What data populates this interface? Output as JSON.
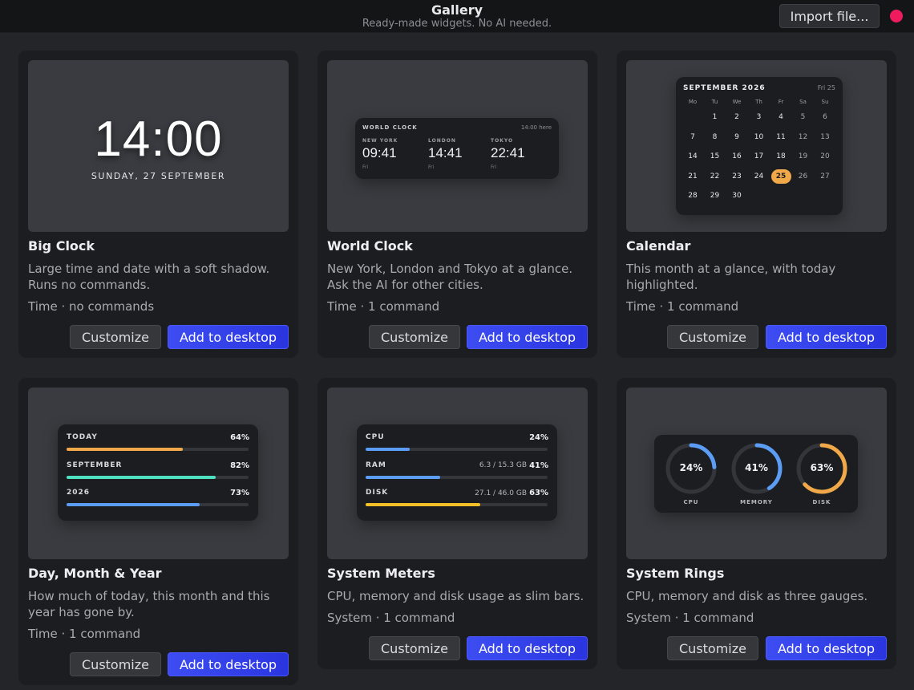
{
  "header": {
    "title": "Gallery",
    "subtitle": "Ready-made widgets. No AI needed.",
    "import_label": "Import file...",
    "status_color": "#ef1b5f"
  },
  "buttons": {
    "customize": "Customize",
    "add": "Add to desktop"
  },
  "accent_color": "#3d4df2",
  "cards": [
    {
      "title": "Big Clock",
      "desc": "Large time and date with a soft shadow. Runs no commands.",
      "meta": "Time · no commands",
      "preview": {
        "time": "14:00",
        "date": "SUNDAY, 27 SEPTEMBER"
      }
    },
    {
      "title": "World Clock",
      "desc": "New York, London and Tokyo at a glance. Ask the AI for other cities.",
      "meta": "Time · 1 command",
      "preview": {
        "label": "WORLD CLOCK",
        "here": "14:00 here",
        "cities": [
          {
            "name": "NEW YORK",
            "time": "09:41",
            "day": "Fri"
          },
          {
            "name": "LONDON",
            "time": "14:41",
            "day": "Fri"
          },
          {
            "name": "TOKYO",
            "time": "22:41",
            "day": "Fri"
          }
        ]
      }
    },
    {
      "title": "Calendar",
      "desc": "This month at a glance, with today highlighted.",
      "meta": "Time · 1 command",
      "preview": {
        "month": "SEPTEMBER 2026",
        "today_label": "Fri 25",
        "weekdays": [
          "Mo",
          "Tu",
          "We",
          "Th",
          "Fr",
          "Sa",
          "Su"
        ],
        "first_weekday_index": 1,
        "days_in_month": 30,
        "today": 25,
        "today_color": "#f0a848"
      }
    },
    {
      "title": "Day, Month & Year",
      "desc": "How much of today, this month and this year has gone by.",
      "meta": "Time · 1 command",
      "preview": {
        "bars": [
          {
            "label": "TODAY",
            "value": "64%",
            "fraction": 0.64,
            "color": "#f0a848"
          },
          {
            "label": "SEPTEMBER",
            "value": "82%",
            "fraction": 0.82,
            "color": "#4fe0c0"
          },
          {
            "label": "2026",
            "value": "73%",
            "fraction": 0.73,
            "color": "#5b9cf5"
          }
        ]
      }
    },
    {
      "title": "System Meters",
      "desc": "CPU, memory and disk usage as slim bars.",
      "meta": "System · 1 command",
      "preview": {
        "bars": [
          {
            "label": "CPU",
            "extra": "",
            "value": "24%",
            "fraction": 0.24,
            "color": "#5b9cf5"
          },
          {
            "label": "RAM",
            "extra": "6.3 / 15.3 GB",
            "value": "41%",
            "fraction": 0.41,
            "color": "#5b9cf5"
          },
          {
            "label": "DISK",
            "extra": "27.1 / 46.0 GB",
            "value": "63%",
            "fraction": 0.63,
            "color": "#f5c027"
          }
        ]
      }
    },
    {
      "title": "System Rings",
      "desc": "CPU, memory and disk as three gauges.",
      "meta": "System · 1 command",
      "preview": {
        "rings": [
          {
            "label": "CPU",
            "value": "24%",
            "fraction": 0.24,
            "color": "#5b9cf5"
          },
          {
            "label": "MEMORY",
            "value": "41%",
            "fraction": 0.41,
            "color": "#5b9cf5"
          },
          {
            "label": "DISK",
            "value": "63%",
            "fraction": 0.63,
            "color": "#f0a848"
          }
        ]
      }
    }
  ]
}
